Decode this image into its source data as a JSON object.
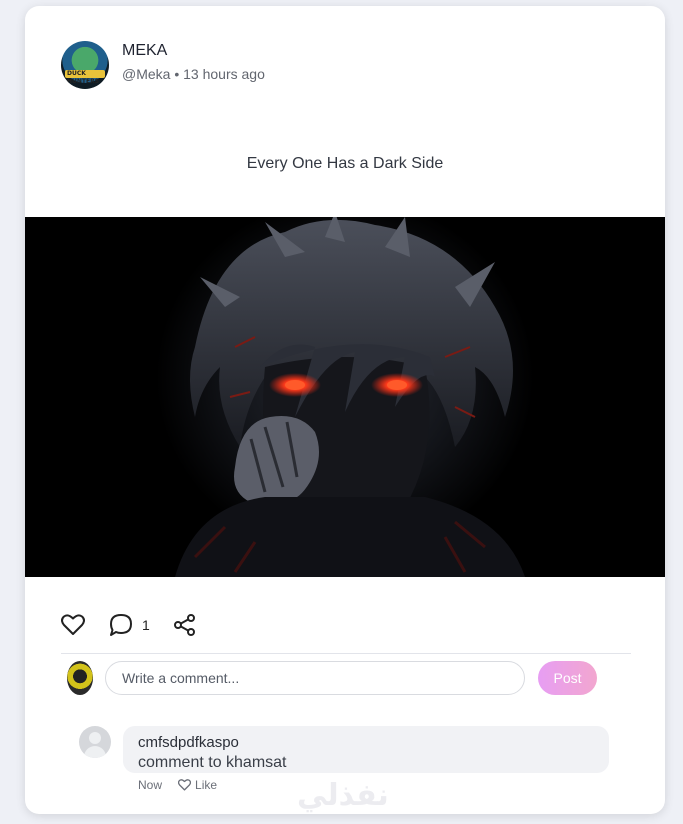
{
  "post": {
    "author_name": "MEKA",
    "author_handle": "@Meka",
    "time_ago": "13 hours ago",
    "separator": "•",
    "avatar_badge": "DUCK HUNTERS",
    "text": "Every One Has a Dark Side",
    "image_desc_icon": "dark-anime-portrait",
    "actions": {
      "like_icon": "heart-icon",
      "comment_icon": "comment-bubble-icon",
      "comment_count": "1",
      "share_icon": "share-icon"
    }
  },
  "composer": {
    "placeholder": "Write a comment...",
    "post_label": "Post"
  },
  "comments": [
    {
      "author": "cmfsdpdfkaspo",
      "text": "comment to khamsat",
      "time": "Now",
      "like_label": "Like"
    }
  ],
  "watermark": "نفذلي",
  "colors": {
    "post_button_gradient_start": "#e79ef3",
    "post_button_gradient_end": "#f2a6cf",
    "eye_glow": "#ff3a1a"
  }
}
